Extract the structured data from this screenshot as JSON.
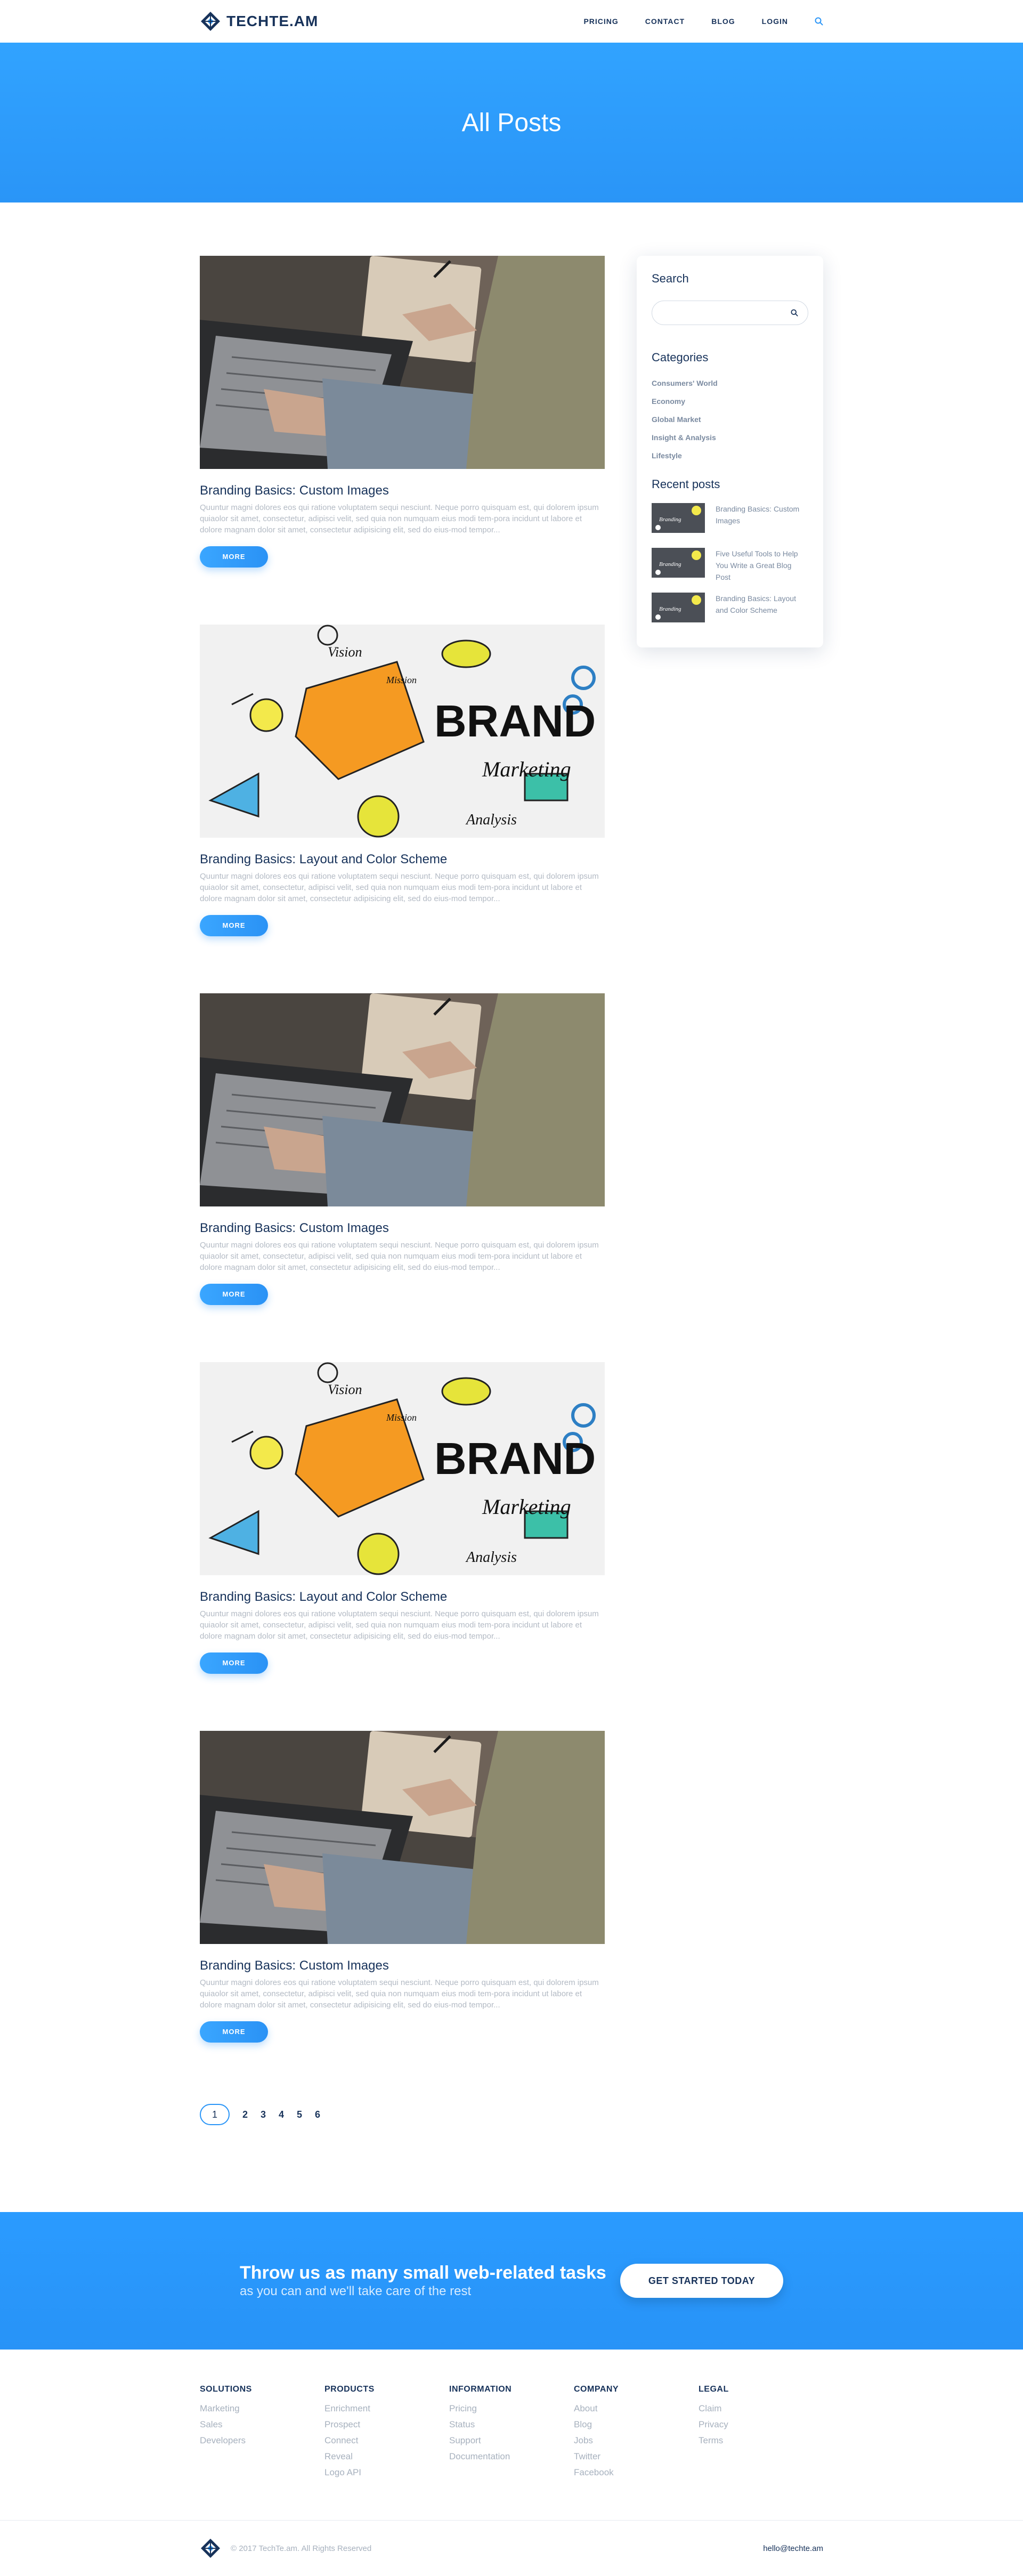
{
  "header": {
    "logo_text": "TECHTE.AM",
    "nav": [
      "PRICING",
      "CONTACT",
      "BLOG",
      "LOGIN"
    ]
  },
  "hero": {
    "title": "All Posts"
  },
  "posts": [
    {
      "title": "Branding Basics: Custom Images",
      "image": "laptop-photo",
      "excerpt": "Quuntur magni dolores eos qui ratione voluptatem sequi nesciunt. Neque porro quisquam est, qui dolorem ipsum quiaolor sit amet, consectetur, adipisci velit, sed quia non numquam eius modi tem-pora incidunt ut labore et dolore magnam dolor sit amet, consectetur adipisicing elit, sed do eius-mod tempor...",
      "more": "MORE"
    },
    {
      "title": "Branding Basics: Layout and Color Scheme",
      "image": "brand-sketch",
      "excerpt": "Quuntur magni dolores eos qui ratione voluptatem sequi nesciunt. Neque porro quisquam est, qui dolorem ipsum quiaolor sit amet, consectetur, adipisci velit, sed quia non numquam eius modi tem-pora incidunt ut labore et dolore magnam dolor sit amet, consectetur adipisicing elit, sed do eius-mod tempor...",
      "more": "MORE"
    },
    {
      "title": "Branding Basics: Custom Images",
      "image": "laptop-photo",
      "excerpt": "Quuntur magni dolores eos qui ratione voluptatem sequi nesciunt. Neque porro quisquam est, qui dolorem ipsum quiaolor sit amet, consectetur, adipisci velit, sed quia non numquam eius modi tem-pora incidunt ut labore et dolore magnam dolor sit amet, consectetur adipisicing elit, sed do eius-mod tempor...",
      "more": "MORE"
    },
    {
      "title": "Branding Basics: Layout and Color Scheme",
      "image": "brand-sketch",
      "excerpt": "Quuntur magni dolores eos qui ratione voluptatem sequi nesciunt. Neque porro quisquam est, qui dolorem ipsum quiaolor sit amet, consectetur, adipisci velit, sed quia non numquam eius modi tem-pora incidunt ut labore et dolore magnam dolor sit amet, consectetur adipisicing elit, sed do eius-mod tempor...",
      "more": "MORE"
    },
    {
      "title": "Branding Basics: Custom Images",
      "image": "laptop-photo",
      "excerpt": "Quuntur magni dolores eos qui ratione voluptatem sequi nesciunt. Neque porro quisquam est, qui dolorem ipsum quiaolor sit amet, consectetur, adipisci velit, sed quia non numquam eius modi tem-pora incidunt ut labore et dolore magnam dolor sit amet, consectetur adipisicing elit, sed do eius-mod tempor...",
      "more": "MORE"
    }
  ],
  "pagination": {
    "current": "1",
    "pages": [
      "2",
      "3",
      "4",
      "5",
      "6"
    ]
  },
  "sidebar": {
    "search_heading": "Search",
    "search_value": "",
    "categories_heading": "Categories",
    "categories": [
      "Consumers' World",
      "Economy",
      "Global Market",
      "Insight & Analysis",
      "Lifestyle"
    ],
    "recent_heading": "Recent posts",
    "recent": [
      {
        "title": "Branding Basics: Custom Images",
        "thumb": "Branding"
      },
      {
        "title": "Five Useful Tools to Help You Write a Great Blog Post",
        "thumb": "Branding"
      },
      {
        "title": "Branding Basics: Layout and Color Scheme",
        "thumb": "Branding"
      }
    ]
  },
  "cta": {
    "title": "Throw us as many small web-related tasks",
    "subtitle": "as you can and we'll take care of the rest",
    "button": "GET STARTED TODAY"
  },
  "footer": {
    "columns": [
      {
        "heading": "SOLUTIONS",
        "links": [
          "Marketing",
          "Sales",
          "Developers"
        ]
      },
      {
        "heading": "PRODUCTS",
        "links": [
          "Enrichment",
          "Prospect",
          "Connect",
          "Reveal",
          "Logo API"
        ]
      },
      {
        "heading": "INFORMATION",
        "links": [
          "Pricing",
          "Status",
          "Support",
          "Documentation"
        ]
      },
      {
        "heading": "COMPANY",
        "links": [
          "About",
          "Blog",
          "Jobs",
          "Twitter",
          "Facebook"
        ]
      },
      {
        "heading": "LEGAL",
        "links": [
          "Claim",
          "Privacy",
          "Terms"
        ]
      }
    ],
    "copyright": "© 2017 TechTe.am. All Rights Reserved",
    "email": "hello@techte.am"
  },
  "colors": {
    "primary": "#2a95f7",
    "navy": "#17325a",
    "muted": "#a7b1be"
  }
}
